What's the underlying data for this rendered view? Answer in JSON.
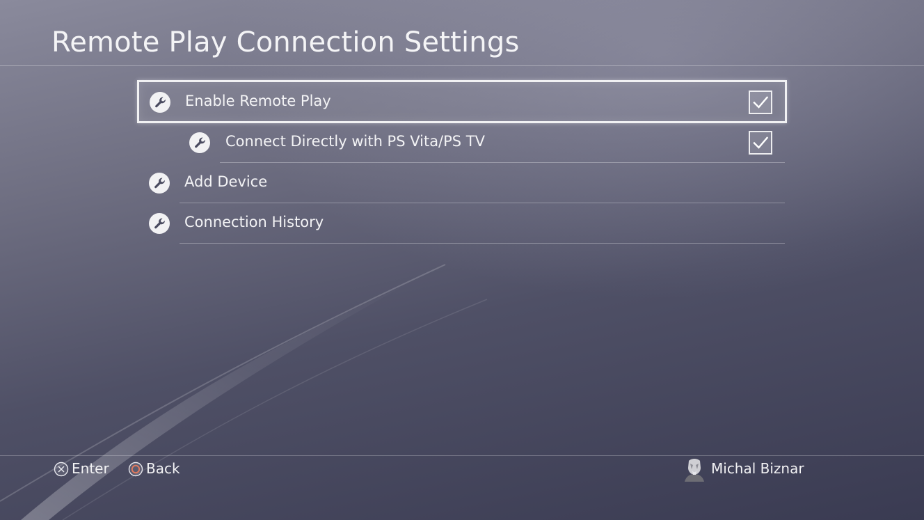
{
  "page": {
    "title": "Remote Play Connection Settings"
  },
  "menu": {
    "items": [
      {
        "label": "Enable Remote Play",
        "icon": "wrench-icon",
        "checked": true,
        "focused": true
      },
      {
        "label": "Connect Directly with PS Vita/PS TV",
        "icon": "wrench-icon",
        "checked": true,
        "focused": false
      },
      {
        "label": "Add Device",
        "icon": "wrench-icon"
      },
      {
        "label": "Connection History",
        "icon": "wrench-icon"
      }
    ]
  },
  "footer": {
    "enter_label": "Enter",
    "enter_icon": "cross-button-icon",
    "back_label": "Back",
    "back_icon": "circle-button-icon",
    "user_name": "Michal Biznar",
    "colors": {
      "circle_button": "#e07a5f",
      "accent_text": "#f2f2f4"
    }
  }
}
